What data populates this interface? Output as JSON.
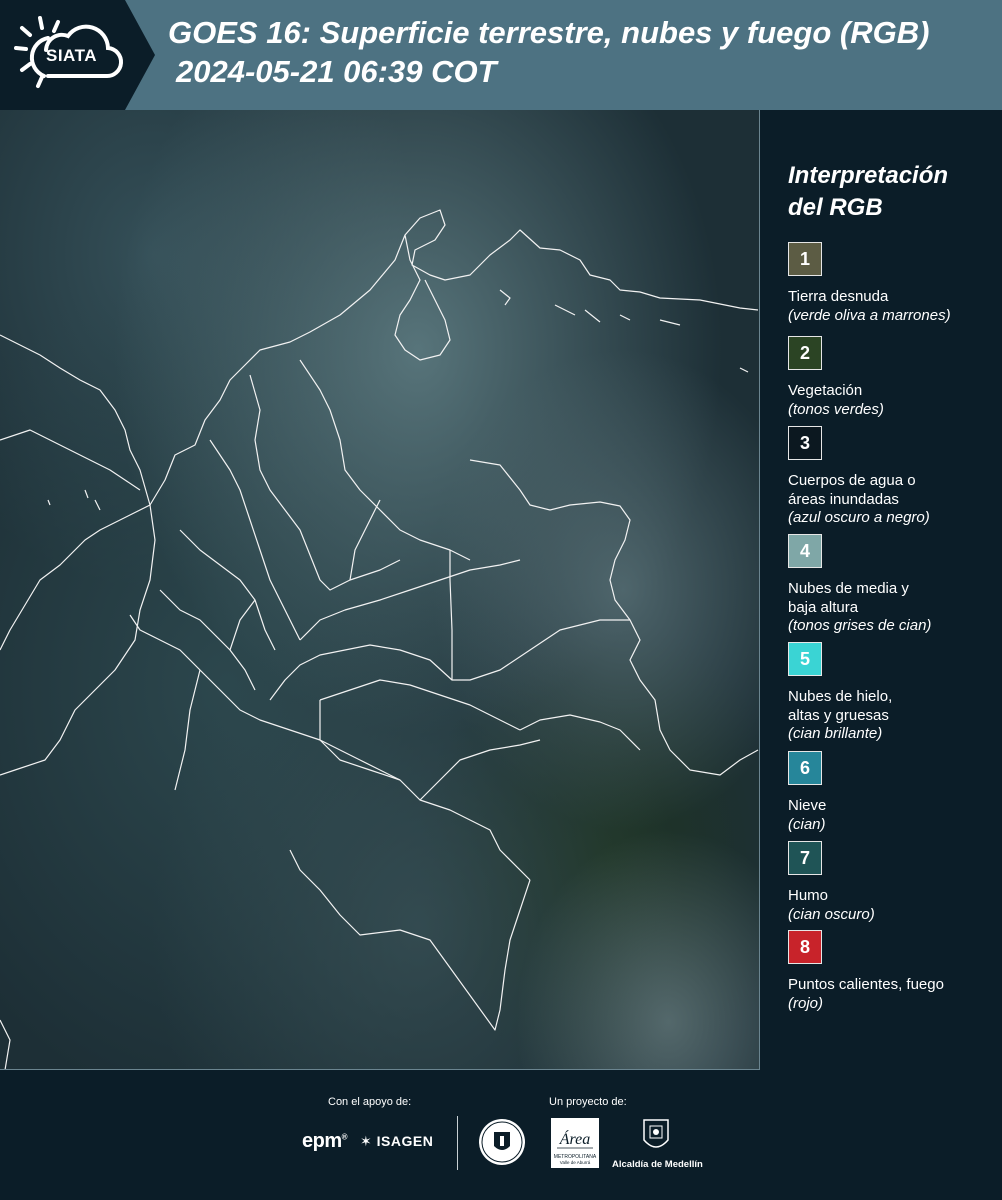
{
  "header": {
    "logo_text": "SIATA",
    "title": "GOES 16: Superficie terrestre, nubes y fuego (RGB)",
    "subtitle": "2024-05-21 06:39 COT"
  },
  "legend": {
    "title_line1": "Interpretación",
    "title_line2": "del RGB",
    "items": [
      {
        "num": "1",
        "label": "Tierra desnuda",
        "desc": "(verde oliva a marrones)",
        "color": "#5c5c44"
      },
      {
        "num": "2",
        "label": "Vegetación",
        "desc": "(tonos verdes)",
        "color": "#2b4424"
      },
      {
        "num": "3",
        "label": "Cuerpos de agua o\náreas inundadas",
        "desc": "(azul oscuro a negro)",
        "color": "#0c1820"
      },
      {
        "num": "4",
        "label": "Nubes de media y\nbaja altura",
        "desc": "(tonos grises de cian)",
        "color": "#7fa7a7"
      },
      {
        "num": "5",
        "label": "Nubes de hielo,\naltas y gruesas",
        "desc": "(cian brillante)",
        "color": "#3ad4d4"
      },
      {
        "num": "6",
        "label": "Nieve",
        "desc": "(cian)",
        "color": "#26869a"
      },
      {
        "num": "7",
        "label": "Humo",
        "desc": "(cian oscuro)",
        "color": "#1f5456"
      },
      {
        "num": "8",
        "label": "Puntos calientes, fuego",
        "desc": "(rojo)",
        "color": "#c8232a"
      }
    ]
  },
  "footer": {
    "support_label": "Con el apoyo de:",
    "project_label": "Un proyecto de:",
    "epm": "epm",
    "isagen": "ISAGEN",
    "area_text": "Área",
    "area_sub": "METROPOLITANA",
    "area_sub2": "Valle de Aburrá",
    "medellin": "Alcaldía de Medellín"
  }
}
